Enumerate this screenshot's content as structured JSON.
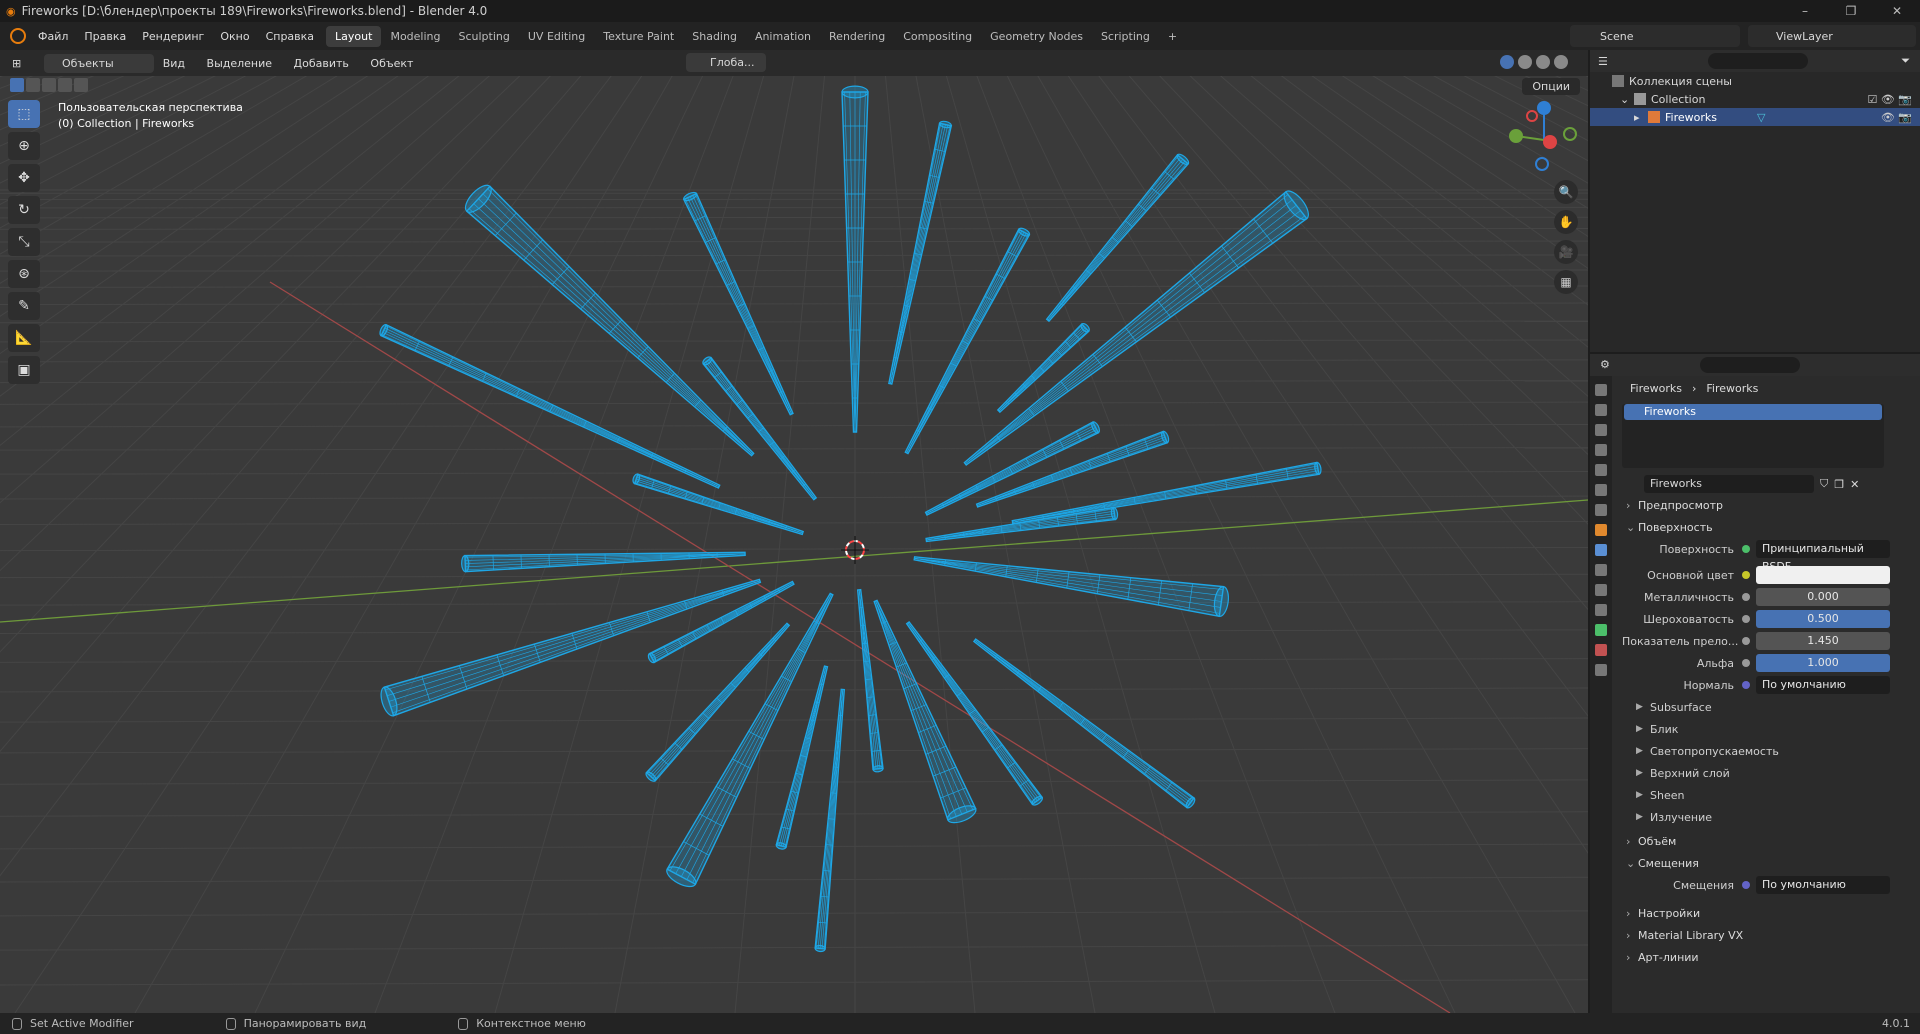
{
  "window": {
    "title": "Fireworks [D:\\блендер\\проекты 189\\Fireworks\\Fireworks.blend] - Blender 4.0",
    "controls": [
      "–",
      "❐",
      "✕"
    ]
  },
  "menu": [
    "Файл",
    "Правка",
    "Рендеринг",
    "Окно",
    "Справка"
  ],
  "workspaces": [
    "Layout",
    "Modeling",
    "Sculpting",
    "UV Editing",
    "Texture Paint",
    "Shading",
    "Animation",
    "Rendering",
    "Compositing",
    "Geometry Nodes",
    "Scripting",
    "+"
  ],
  "scene": "Scene",
  "view_layer": "ViewLayer",
  "viewport": {
    "mode": "Объекты",
    "menus": [
      "Вид",
      "Выделение",
      "Добавить",
      "Объект"
    ],
    "transform": "Глоба...",
    "options": "Опции",
    "info_line1": "Пользовательская перспектива",
    "info_line2": "(0) Collection | Fireworks",
    "wire_color": "#1ea7e6"
  },
  "outliner": {
    "root": "Коллекция сцены",
    "collection": "Collection",
    "object": "Fireworks"
  },
  "properties": {
    "breadcrumb_object": "Fireworks",
    "breadcrumb_material": "Fireworks",
    "slot": "Fireworks",
    "material_name": "Fireworks",
    "panels": {
      "preview": "Предпросмотр",
      "surface": "Поверхность",
      "volume": "Объём",
      "displacement": "Смещения",
      "settings": "Настройки",
      "library": "Material Library VX",
      "lineart": "Арт-линии"
    },
    "surface_field": {
      "label": "Поверхность",
      "value": "Принципиальный BSDF"
    },
    "fields": [
      {
        "label": "Основной цвет",
        "value": ""
      },
      {
        "label": "Металличность",
        "value": "0.000"
      },
      {
        "label": "Шероховатость",
        "value": "0.500"
      },
      {
        "label": "Показатель прело...",
        "value": "1.450"
      },
      {
        "label": "Альфа",
        "value": "1.000"
      },
      {
        "label": "Нормаль",
        "value": "По умолчанию"
      }
    ],
    "subpanels": [
      "Subsurface",
      "Блик",
      "Светопропускаемость",
      "Верхний слой",
      "Sheen",
      "Излучение"
    ],
    "displacement_field": {
      "label": "Смещения",
      "value": "По умолчанию"
    }
  },
  "status": {
    "items": [
      "Set Active Modifier",
      "Панорамировать вид",
      "Контекстное меню"
    ],
    "version": "4.0.1"
  }
}
